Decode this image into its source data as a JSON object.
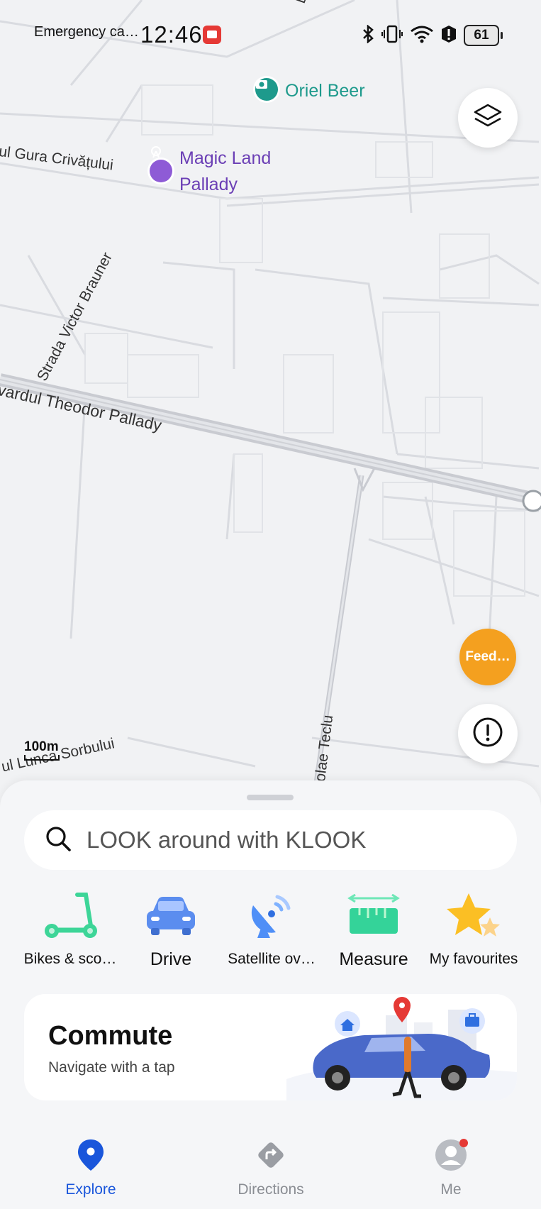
{
  "status_bar": {
    "carrier": "Emergency ca…",
    "time": "12:46",
    "battery": "61"
  },
  "map": {
    "pois": [
      {
        "name": "Oriel Beer",
        "color": "#1e9a8c",
        "icon": "camera-icon"
      },
      {
        "name": "Magic Land\nPallady",
        "name_line1": "Magic Land",
        "name_line2": "Pallady",
        "color": "#6b3fb5",
        "icon": "amusement-park-icon"
      }
    ],
    "street_labels": {
      "gura": "ul Gura Crivățului",
      "victor": "Strada Victor Brauner",
      "theodor": "vardul Theodor Pallady",
      "teclu": "olae Teclu",
      "lunca": "ul Lunca Sorbului",
      "dr_top": "Dr"
    },
    "scale": "100m"
  },
  "buttons": {
    "feedback": "Feed…"
  },
  "search": {
    "placeholder": "LOOK around with KLOOK"
  },
  "tools": [
    {
      "label": "Bikes & sco…",
      "icon": "scooter-icon"
    },
    {
      "label": "Drive",
      "icon": "car-icon"
    },
    {
      "label": "Satellite ov…",
      "icon": "satellite-icon"
    },
    {
      "label": "Measure",
      "icon": "ruler-icon"
    },
    {
      "label": "My favourites",
      "icon": "star-icon"
    }
  ],
  "commute": {
    "title": "Commute",
    "subtitle": "Navigate with a tap"
  },
  "nav": {
    "items": [
      {
        "label": "Explore",
        "active": true,
        "icon": "location-pin-icon"
      },
      {
        "label": "Directions",
        "active": false,
        "icon": "directions-icon"
      },
      {
        "label": "Me",
        "active": false,
        "icon": "profile-icon"
      }
    ],
    "active_color": "#1a56db",
    "inactive_color": "#8a8d93"
  }
}
